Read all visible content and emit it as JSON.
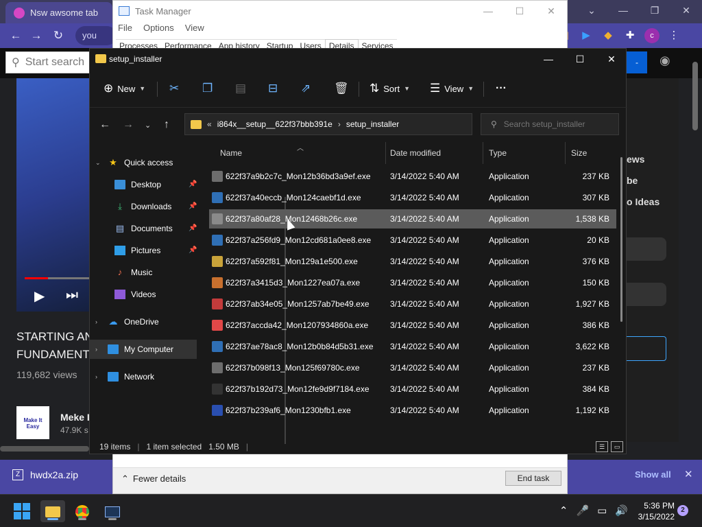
{
  "browser": {
    "tab_title": "Nsw awsome tab",
    "omnibox_text": "you",
    "search_placeholder": "Start search",
    "video_title_line1": "STARTING AN",
    "video_title_line2": "FUNDAMENT",
    "video_views": "119,682 views",
    "channel_name": "Meke I",
    "channel_subs": "47.9K s",
    "channel_logo_text": "Make It Easy",
    "right_panel_texts": [
      "ews",
      "be",
      "o Ideas"
    ],
    "extension_avatar": "c"
  },
  "download_bar": {
    "file_name": "hwdx2a.zip",
    "show_all": "Show all"
  },
  "task_manager": {
    "title": "Task Manager",
    "menu": [
      "File",
      "Options",
      "View"
    ],
    "tabs": [
      "Processes",
      "Performance",
      "App history",
      "Startup",
      "Users",
      "Details",
      "Services"
    ],
    "active_tab": "Details",
    "fewer_details": "Fewer details",
    "end_task": "End task"
  },
  "explorer": {
    "title": "setup_installer",
    "toolbar": {
      "new": "New",
      "sort": "Sort",
      "view": "View",
      "more": "···"
    },
    "address": {
      "prefix": "«",
      "parent": "i864x__setup__622f37bbb391e",
      "separator": "›",
      "current": "setup_installer"
    },
    "search_placeholder": "Search setup_installer",
    "nav": {
      "quick_access": "Quick access",
      "desktop": "Desktop",
      "downloads": "Downloads",
      "documents": "Documents",
      "pictures": "Pictures",
      "music": "Music",
      "videos": "Videos",
      "onedrive": "OneDrive",
      "my_computer": "My Computer",
      "network": "Network"
    },
    "columns": {
      "name": "Name",
      "date": "Date modified",
      "type": "Type",
      "size": "Size"
    },
    "files": [
      {
        "name": "622f37a9b2c7c_Mon12b36bd3a9ef.exe",
        "date": "3/14/2022 5:40 AM",
        "type": "Application",
        "size": "237 KB",
        "icon_color": "#6d6d6d"
      },
      {
        "name": "622f37a40eccb_Mon124caebf1d.exe",
        "date": "3/14/2022 5:40 AM",
        "type": "Application",
        "size": "307 KB",
        "icon_color": "#2f6fb5"
      },
      {
        "name": "622f37a80af28_Mon12468b26c.exe",
        "date": "3/14/2022 5:40 AM",
        "type": "Application",
        "size": "1,538 KB",
        "icon_color": "#8a8a8a"
      },
      {
        "name": "622f37a256fd9_Mon12cd681a0ee8.exe",
        "date": "3/14/2022 5:40 AM",
        "type": "Application",
        "size": "20 KB",
        "icon_color": "#2f6fb5"
      },
      {
        "name": "622f37a592f81_Mon129a1e500.exe",
        "date": "3/14/2022 5:40 AM",
        "type": "Application",
        "size": "376 KB",
        "icon_color": "#c9a33a"
      },
      {
        "name": "622f37a3415d3_Mon1227ea07a.exe",
        "date": "3/14/2022 5:40 AM",
        "type": "Application",
        "size": "150 KB",
        "icon_color": "#c8702e"
      },
      {
        "name": "622f37ab34e05_Mon1257ab7be49.exe",
        "date": "3/14/2022 5:40 AM",
        "type": "Application",
        "size": "1,927 KB",
        "icon_color": "#c23b3b"
      },
      {
        "name": "622f37accda42_Mon1207934860a.exe",
        "date": "3/14/2022 5:40 AM",
        "type": "Application",
        "size": "386 KB",
        "icon_color": "#e04848"
      },
      {
        "name": "622f37ae78ac8_Mon12b0b84d5b31.exe",
        "date": "3/14/2022 5:40 AM",
        "type": "Application",
        "size": "3,622 KB",
        "icon_color": "#2f6fb5"
      },
      {
        "name": "622f37b098f13_Mon125f69780c.exe",
        "date": "3/14/2022 5:40 AM",
        "type": "Application",
        "size": "237 KB",
        "icon_color": "#6d6d6d"
      },
      {
        "name": "622f37b192d73_Mon12fe9d9f7184.exe",
        "date": "3/14/2022 5:40 AM",
        "type": "Application",
        "size": "384 KB",
        "icon_color": "#333333"
      },
      {
        "name": "622f37b239af6_Mon1230bfb1.exe",
        "date": "3/14/2022 5:40 AM",
        "type": "Application",
        "size": "1,192 KB",
        "icon_color": "#2a4fb0"
      }
    ],
    "selected_index": 2,
    "status": {
      "items": "19 items",
      "selected": "1 item selected",
      "size": "1.50 MB"
    }
  },
  "taskbar": {
    "time": "5:36 PM",
    "date": "3/15/2022",
    "notifications": "2"
  }
}
